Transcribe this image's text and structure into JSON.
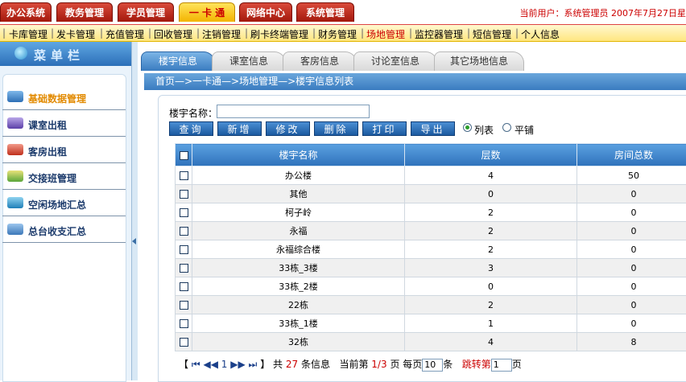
{
  "header": {
    "main_tabs": [
      {
        "label": "办公系统",
        "active": false
      },
      {
        "label": "教务管理",
        "active": false
      },
      {
        "label": "学员管理",
        "active": false
      },
      {
        "label": "一 卡 通",
        "active": true
      },
      {
        "label": "网络中心",
        "active": false
      },
      {
        "label": "系统管理",
        "active": false
      }
    ],
    "user_info": "当前用户：系统管理员   2007年7月27日星"
  },
  "submenu": {
    "items": [
      "卡库管理",
      "发卡管理",
      "充值管理",
      "回收管理",
      "注销管理",
      "刷卡终端管理",
      "财务管理",
      "场地管理",
      "监控器管理",
      "短信管理",
      "个人信息"
    ],
    "active": "场地管理"
  },
  "sidebar": {
    "title": "菜单栏",
    "items": [
      {
        "label": "基础数据管理",
        "icon": "data-management-icon",
        "active": true
      },
      {
        "label": "课室出租",
        "icon": "classroom-rent-icon",
        "active": false
      },
      {
        "label": "客房出租",
        "icon": "guestroom-rent-icon",
        "active": false
      },
      {
        "label": "交接班管理",
        "icon": "shift-handover-icon",
        "active": false
      },
      {
        "label": "空闲场地汇总",
        "icon": "vacant-venue-icon",
        "active": false
      },
      {
        "label": "总台收支汇总",
        "icon": "front-desk-summary-icon",
        "active": false
      }
    ]
  },
  "content_tabs": [
    "楼宇信息",
    "课室信息",
    "客房信息",
    "讨论室信息",
    "其它场地信息"
  ],
  "breadcrumb": "首页—>一卡通—>场地管理—>楼宇信息列表",
  "search": {
    "label": "楼宇名称：",
    "value": "",
    "placeholder": ""
  },
  "buttons": [
    "查询",
    "新增",
    "修改",
    "删除",
    "打印",
    "导出"
  ],
  "view_mode": {
    "options": [
      "列表",
      "平铺"
    ],
    "selected": "列表"
  },
  "table": {
    "columns": [
      "楼宇名称",
      "层数",
      "房间总数"
    ],
    "rows": [
      [
        "办公楼",
        "4",
        "50"
      ],
      [
        "其他",
        "0",
        "0"
      ],
      [
        "柯子岭",
        "2",
        "0"
      ],
      [
        "永福",
        "2",
        "0"
      ],
      [
        "永福综合楼",
        "2",
        "0"
      ],
      [
        "33栋_3楼",
        "3",
        "0"
      ],
      [
        "33栋_2楼",
        "0",
        "0"
      ],
      [
        "22栋",
        "2",
        "0"
      ],
      [
        "33栋_1楼",
        "1",
        "0"
      ],
      [
        "32栋",
        "4",
        "8"
      ]
    ]
  },
  "pager": {
    "open_bracket": "【",
    "first": "⏮",
    "prev": "◀◀",
    "current": "1",
    "next": "▶▶",
    "last": "⏭",
    "close_bracket": "】",
    "total_prefix": "共",
    "total": "27",
    "total_suffix": "条信息",
    "page_prefix": "当前第",
    "page_value": "1/3",
    "page_suffix": "页",
    "per_page_prefix": "每页",
    "per_page": "10",
    "per_page_suffix": "条",
    "jump_prefix": "跳转第",
    "jump_value": "1",
    "jump_suffix": "页"
  },
  "colors": {
    "accent_red": "#c00000",
    "accent_blue": "#2f72bb",
    "active_tab_yellow": "#f3b400"
  }
}
